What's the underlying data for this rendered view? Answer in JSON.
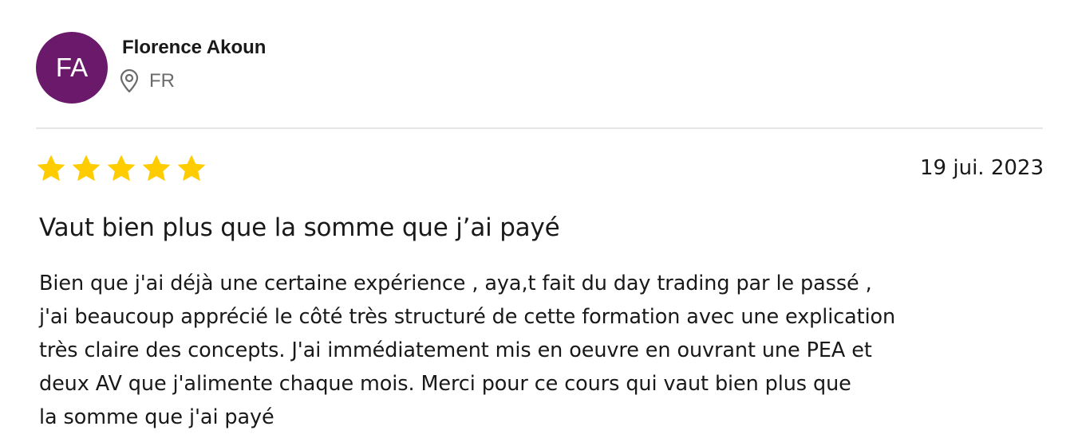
{
  "reviewer": {
    "initials": "FA",
    "name": "Florence Akoun",
    "country": "FR",
    "avatar_color": "#6b1a6b",
    "location_icon": "location-pin-icon"
  },
  "review": {
    "rating": 5,
    "max_rating": 5,
    "star_color": "#ffcc00",
    "date": "19 jui. 2023",
    "title": "Vaut bien plus que la somme que j’ai payé",
    "body_lines": [
      "Bien que j'ai déjà une certaine expérience , aya,t fait du day trading par le passé ,",
      "j'ai beaucoup apprécié le côté très structuré de cette formation avec une explication",
      "très claire des concepts. J'ai immédiatement mis en oeuvre en ouvrant une PEA et",
      "deux AV que j'alimente chaque mois. Merci pour ce cours qui vaut bien plus que",
      "la somme que j'ai payé"
    ]
  }
}
